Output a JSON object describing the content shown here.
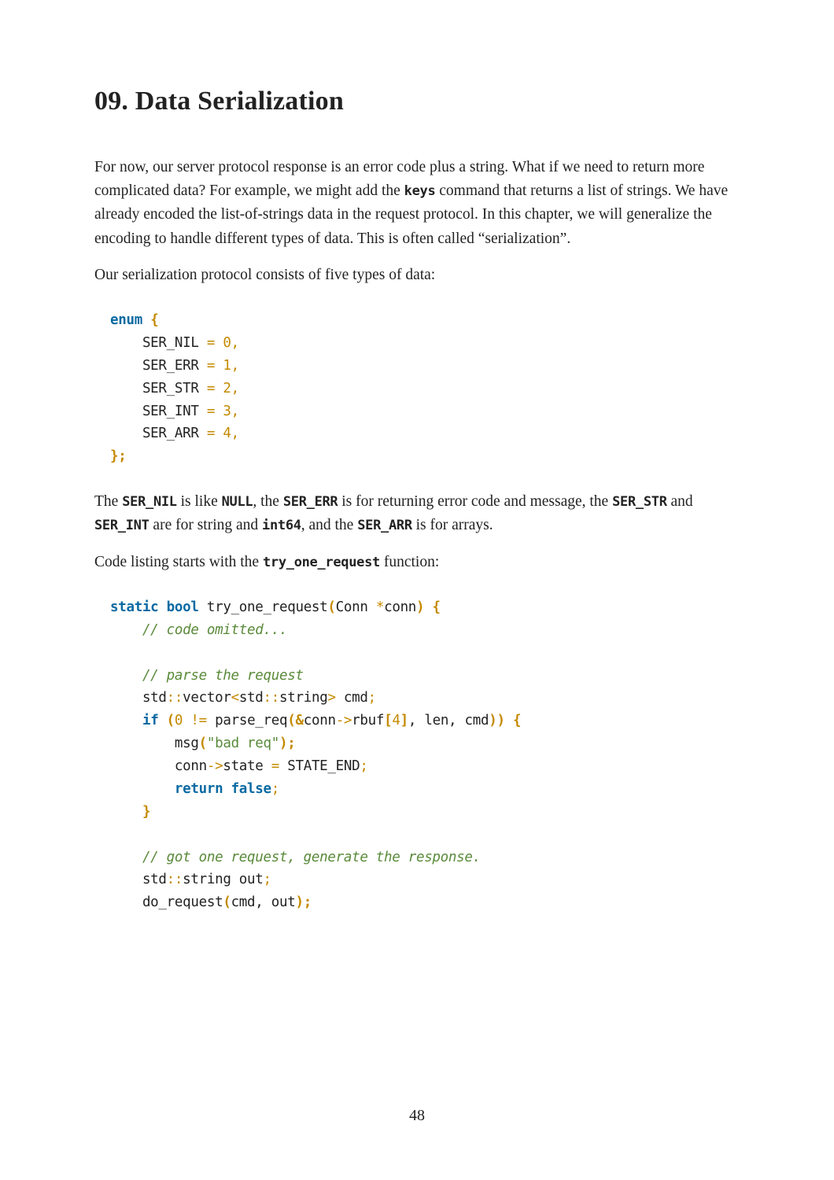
{
  "title": "09. Data Serialization",
  "para1_a": "For now, our server protocol response is an error code plus a string. What if we need to return more complicated data? For example, we might add the ",
  "para1_keys": "keys",
  "para1_b": " command that returns a list of strings. We have already encoded the list-of-strings data in the request protocol. In this chapter, we will generalize the encoding to handle different types of data. This is often called “serialization”.",
  "para2": "Our serialization protocol consists of five types of data:",
  "code1": {
    "enum": "enum",
    "ob": "{",
    "l1a": "    SER_NIL ",
    "eq": "=",
    "sp": " ",
    "n0": "0",
    "comma": ",",
    "l2a": "    SER_ERR ",
    "n1": "1",
    "l3a": "    SER_STR ",
    "n2": "2",
    "l4a": "    SER_INT ",
    "n3": "3",
    "l5a": "    SER_ARR ",
    "n4": "4",
    "cb": "};"
  },
  "para3_a": "The ",
  "c_sernil": "SER_NIL",
  "para3_b": " is like ",
  "c_null": "NULL",
  "para3_c": ", the ",
  "c_sererr": "SER_ERR",
  "para3_d": " is for returning error code and message, the ",
  "c_serstr": "SER_STR",
  "para3_e": " and ",
  "c_serint": "SER_INT",
  "para3_f": " are for string and ",
  "c_int64": "int64",
  "para3_g": ", and the ",
  "c_serarr": "SER_ARR",
  "para3_h": " is for arrays.",
  "para4_a": "Code listing starts with the ",
  "c_tryone": "try_one_request",
  "para4_b": " function:",
  "code2": {
    "kw_static": "static",
    "kw_bool": "bool",
    "fn": " try_one_request",
    "lp": "(",
    "arg": "Conn ",
    "star": "*",
    "argn": "conn",
    "rp": ")",
    "ob": " {",
    "c1": "    // code omitted...",
    "c2": "    // parse the request",
    "l_vec_a": "    std",
    "dcol": "::",
    "l_vec_b": "vector",
    "lt": "<",
    "l_vec_c": "std",
    "l_vec_d": "string",
    "gt": ">",
    "l_vec_e": " cmd",
    "semi": ";",
    "kw_if": "if",
    "if_lp": " (",
    "n0": "0",
    "neq": " != ",
    "call": "parse_req",
    "amp": "(&",
    "conn": "conn",
    "arrow": "->",
    "rbuf": "rbuf",
    "lb": "[",
    "n4": "4",
    "rb": "]",
    "rest": ", len, cmd",
    "cp2": "))",
    "ob2": " {",
    "msg_a": "        msg",
    "msg_lp": "(",
    "msg_s": "\"bad req\"",
    "msg_rp": ");",
    "st_a": "        conn",
    "st_b": "state ",
    "eq": "=",
    "st_c": " STATE_END",
    "kw_ret": "return",
    "kw_false": "false",
    "ret_ind": "        ",
    "cb_inner": "    }",
    "c3": "    // got one request, generate the response.",
    "out_a": "    std",
    "out_b": "string out",
    "do_a": "    do_request",
    "do_lp": "(",
    "do_args": "cmd, out",
    "do_rp": ");"
  },
  "page_number": "48"
}
